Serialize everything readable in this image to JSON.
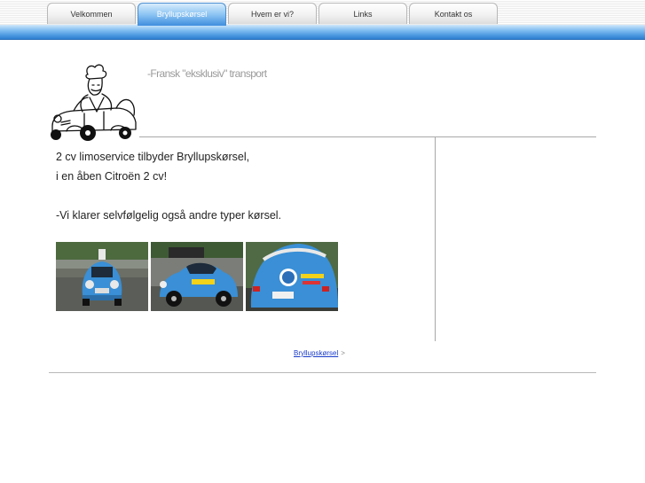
{
  "nav": {
    "tabs": [
      {
        "label": "Velkommen",
        "active": false
      },
      {
        "label": "Bryllupskørsel",
        "active": true
      },
      {
        "label": "Hvem er vi?",
        "active": false
      },
      {
        "label": "Links",
        "active": false
      },
      {
        "label": "Kontakt os",
        "active": false
      }
    ]
  },
  "header": {
    "tagline": "-Fransk \"eksklusiv\" transport",
    "logo_icon": "chef-driving-2cv-icon"
  },
  "main": {
    "line1": "2 cv limoservice tilbyder Bryllupskørsel,",
    "line2": "i en åben Citroën 2 cv!",
    "line3": "-Vi klarer selvfølgelig også andre typer kørsel.",
    "photos": [
      "car-photo-front",
      "car-photo-side",
      "car-photo-rear"
    ]
  },
  "footer": {
    "link_label": "Bryllupskørsel",
    "arrow": ">"
  },
  "colors": {
    "accent_blue": "#3f8ede",
    "link_blue": "#1a3cc8",
    "car_blue": "#3a8fd6"
  }
}
